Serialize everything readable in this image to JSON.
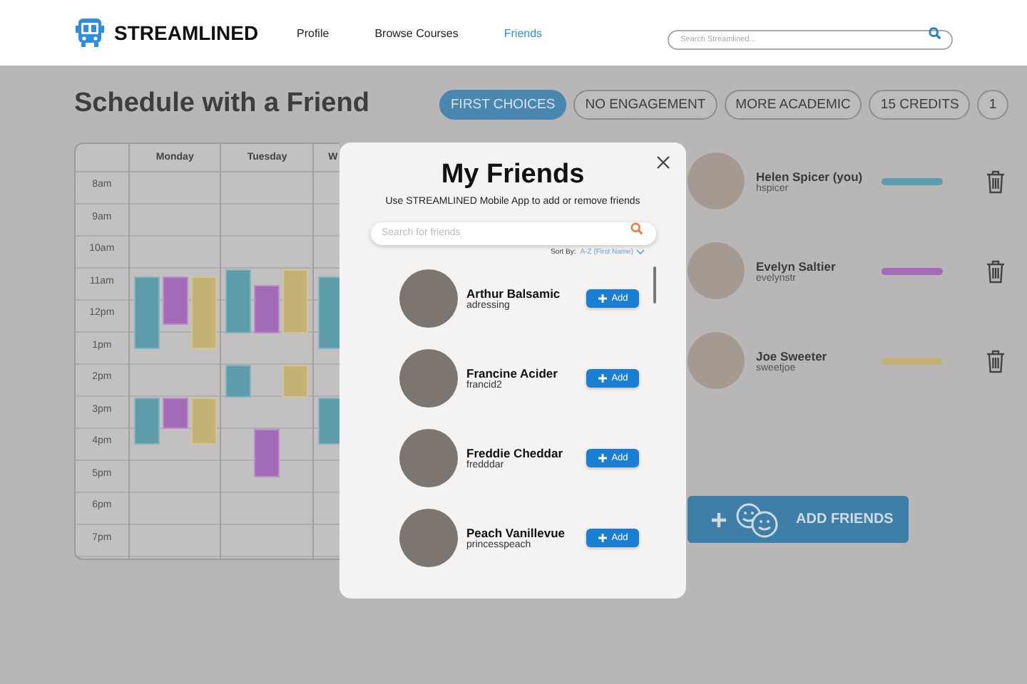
{
  "header": {
    "brand": "STREAMLINED",
    "nav": [
      {
        "label": "Profile",
        "selected": false
      },
      {
        "label": "Browse Courses",
        "selected": false
      },
      {
        "label": "Friends",
        "selected": true
      }
    ],
    "search": {
      "placeholder": "Search Streamlined..."
    }
  },
  "title": "Schedule with a Friend",
  "chips": [
    {
      "label": "FIRST CHOICES",
      "selected": true
    },
    {
      "label": "NO ENGAGEMENT",
      "selected": false
    },
    {
      "label": "MORE ACADEMIC",
      "selected": false
    },
    {
      "label": "15 CREDITS",
      "selected": false
    },
    {
      "label": "1",
      "selected": false
    }
  ],
  "calendar": {
    "times": [
      "8am",
      "9am",
      "10am",
      "11am",
      "12pm",
      "1pm",
      "2pm",
      "3pm",
      "4pm",
      "5pm",
      "6pm",
      "7pm"
    ],
    "days": [
      {
        "label": "Monday"
      },
      {
        "label": "Tuesday"
      },
      {
        "label": "W"
      }
    ]
  },
  "friends": [
    {
      "name": "Helen Spicer (you)",
      "username": "hspicer",
      "color": "#5e9dab"
    },
    {
      "name": "Evelyn Saltier",
      "username": "evelynstr",
      "color": "#a36bb7"
    },
    {
      "name": "Joe Sweeter",
      "username": "sweetjoe",
      "color": "#c4b274"
    }
  ],
  "add_friends_button": "ADD FRIENDS",
  "modal": {
    "title": "My Friends",
    "subtitle": "Use STREAMLINED Mobile App to add or remove friends",
    "search": {
      "placeholder": "Search for friends"
    },
    "sort": {
      "label": "Sort By:",
      "value": "A-Z (First Name)"
    },
    "people": [
      {
        "name": "Arthur Balsamic",
        "username": "adressing",
        "action": "Add"
      },
      {
        "name": "Francine Acider",
        "username": "francid2",
        "action": "Add"
      },
      {
        "name": "Freddie Cheddar",
        "username": "fredddar",
        "action": "Add"
      },
      {
        "name": "Peach Vanillevue",
        "username": "princesspeach",
        "action": "Add"
      }
    ]
  }
}
